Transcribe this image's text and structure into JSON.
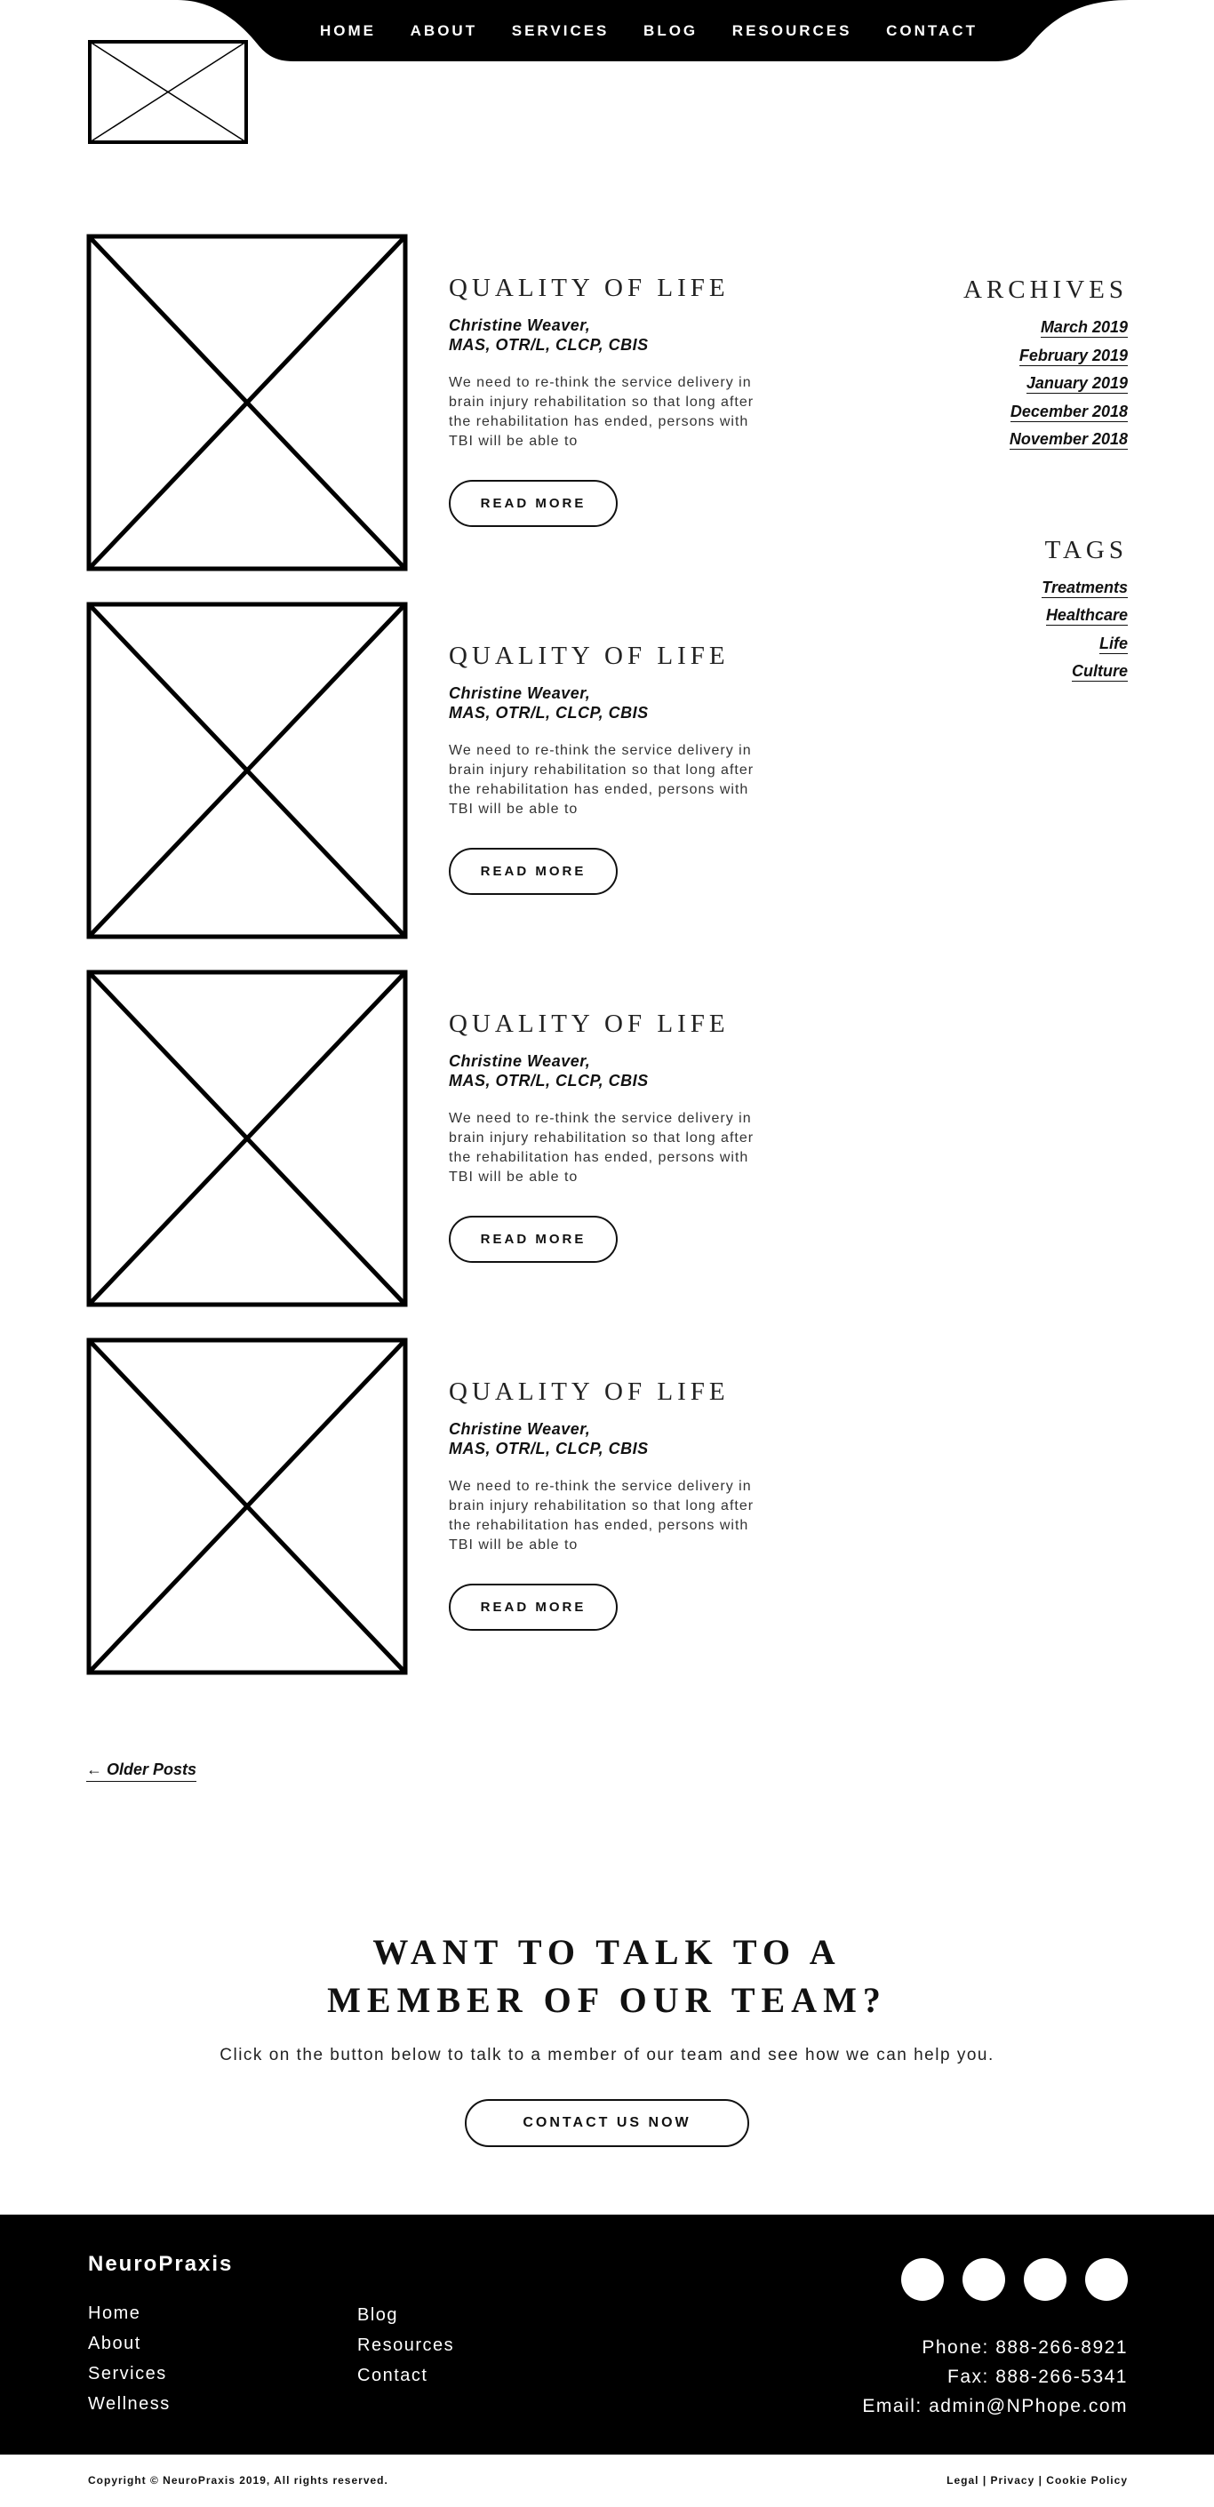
{
  "nav": {
    "items": [
      {
        "label": "HOME"
      },
      {
        "label": "ABOUT"
      },
      {
        "label": "SERVICES"
      },
      {
        "label": "BLOG"
      },
      {
        "label": "RESOURCES"
      },
      {
        "label": "CONTACT"
      }
    ]
  },
  "posts": [
    {
      "title": "QUALITY OF LIFE",
      "author_name": "Christine Weaver,",
      "author_creds": "MAS, OTR/L, CLCP, CBIS",
      "excerpt": "We need to re-think the service delivery in brain injury rehabilitation so that long after the rehabilitation has ended, persons with TBI will be able to",
      "button": "READ MORE"
    },
    {
      "title": "QUALITY OF LIFE",
      "author_name": "Christine Weaver,",
      "author_creds": "MAS, OTR/L, CLCP, CBIS",
      "excerpt": "We need to re-think the service delivery in brain injury rehabilitation so that long after the rehabilitation has ended, persons with TBI will be able to",
      "button": "READ MORE"
    },
    {
      "title": "QUALITY OF LIFE",
      "author_name": "Christine Weaver,",
      "author_creds": "MAS, OTR/L, CLCP, CBIS",
      "excerpt": "We need to re-think the service delivery in brain injury rehabilitation so that long after the rehabilitation has ended, persons with TBI will be able to",
      "button": "READ MORE"
    },
    {
      "title": "QUALITY OF LIFE",
      "author_name": "Christine Weaver,",
      "author_creds": "MAS, OTR/L, CLCP, CBIS",
      "excerpt": "We need to re-think the service delivery in brain injury rehabilitation so that long after the rehabilitation has ended, persons with TBI will be able to",
      "button": "READ MORE"
    }
  ],
  "sidebar": {
    "archives_heading": "ARCHIVES",
    "archives": [
      "March 2019",
      "February 2019",
      "January 2019",
      "December 2018",
      "November 2018"
    ],
    "tags_heading": "TAGS",
    "tags": [
      "Treatments",
      "Healthcare",
      "Life",
      "Culture"
    ]
  },
  "older_posts": "← Older Posts",
  "cta": {
    "heading_line1": "WANT TO TALK TO A",
    "heading_line2": "MEMBER OF OUR TEAM?",
    "text": "Click on the button below to talk to a member of our team and see how we can help you.",
    "button": "CONTACT US NOW"
  },
  "footer": {
    "brand": "NeuroPraxis",
    "col1": [
      "Home",
      "About",
      "Services",
      "Wellness"
    ],
    "col2": [
      "Blog",
      "Resources",
      "Contact"
    ],
    "phone": "Phone: 888-266-8921",
    "fax": "Fax: 888-266-5341",
    "email": "Email: admin@NPhope.com",
    "copyright": "Copyright © NeuroPraxis 2019, All rights reserved.",
    "legal": "Legal",
    "privacy": "Privacy",
    "cookie": "Cookie Policy"
  },
  "colors": {
    "primary": "#000000",
    "background": "#ffffff"
  }
}
